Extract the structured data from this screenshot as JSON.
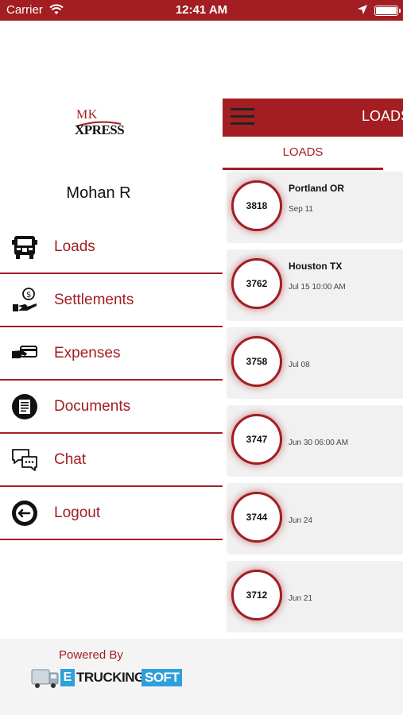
{
  "status_bar": {
    "carrier": "Carrier",
    "time": "12:41 AM"
  },
  "drawer": {
    "logo_line1": "MK",
    "logo_line2": "XPRESS",
    "user_name": "Mohan R",
    "menu": [
      {
        "label": "Loads",
        "icon": "truck-icon"
      },
      {
        "label": "Settlements",
        "icon": "money-hand-icon"
      },
      {
        "label": "Expenses",
        "icon": "card-hand-icon"
      },
      {
        "label": "Documents",
        "icon": "document-icon"
      },
      {
        "label": "Chat",
        "icon": "chat-icon"
      },
      {
        "label": "Logout",
        "icon": "logout-icon"
      }
    ]
  },
  "main": {
    "title": "LOADS",
    "tab": "LOADS",
    "loads": [
      {
        "id": "3818",
        "city": "Portland OR",
        "date": "Sep 11"
      },
      {
        "id": "3762",
        "city": "Houston TX",
        "date": "Jul 15 10:00 AM"
      },
      {
        "id": "3758",
        "city": "",
        "date": "Jul 08"
      },
      {
        "id": "3747",
        "city": "",
        "date": "Jun 30 06:00 AM"
      },
      {
        "id": "3744",
        "city": "",
        "date": "Jun 24"
      },
      {
        "id": "3712",
        "city": "",
        "date": "Jun 21"
      }
    ]
  },
  "footer": {
    "powered_by": "Powered By",
    "brand_e": "E",
    "brand_trucking": "TRUCKING",
    "brand_soft": "SOFT"
  },
  "colors": {
    "accent": "#a21e22",
    "brand_blue": "#2ea0dc",
    "card_bg": "#f1f1f1"
  }
}
